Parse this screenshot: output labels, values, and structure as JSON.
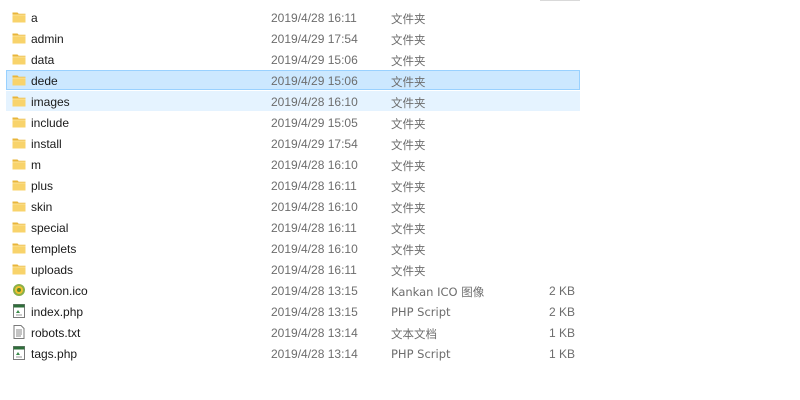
{
  "files": [
    {
      "name": "a",
      "date": "2019/4/28 16:11",
      "type": "文件夹",
      "size": "",
      "icon": "folder-icon"
    },
    {
      "name": "admin",
      "date": "2019/4/29 17:54",
      "type": "文件夹",
      "size": "",
      "icon": "folder-icon"
    },
    {
      "name": "data",
      "date": "2019/4/29 15:06",
      "type": "文件夹",
      "size": "",
      "icon": "folder-icon"
    },
    {
      "name": "dede",
      "date": "2019/4/29 15:06",
      "type": "文件夹",
      "size": "",
      "icon": "folder-icon"
    },
    {
      "name": "images",
      "date": "2019/4/28 16:10",
      "type": "文件夹",
      "size": "",
      "icon": "folder-icon"
    },
    {
      "name": "include",
      "date": "2019/4/29 15:05",
      "type": "文件夹",
      "size": "",
      "icon": "folder-icon"
    },
    {
      "name": "install",
      "date": "2019/4/29 17:54",
      "type": "文件夹",
      "size": "",
      "icon": "folder-icon"
    },
    {
      "name": "m",
      "date": "2019/4/28 16:10",
      "type": "文件夹",
      "size": "",
      "icon": "folder-icon"
    },
    {
      "name": "plus",
      "date": "2019/4/28 16:11",
      "type": "文件夹",
      "size": "",
      "icon": "folder-icon"
    },
    {
      "name": "skin",
      "date": "2019/4/28 16:10",
      "type": "文件夹",
      "size": "",
      "icon": "folder-icon"
    },
    {
      "name": "special",
      "date": "2019/4/28 16:11",
      "type": "文件夹",
      "size": "",
      "icon": "folder-icon"
    },
    {
      "name": "templets",
      "date": "2019/4/28 16:10",
      "type": "文件夹",
      "size": "",
      "icon": "folder-icon"
    },
    {
      "name": "uploads",
      "date": "2019/4/28 16:11",
      "type": "文件夹",
      "size": "",
      "icon": "folder-icon"
    },
    {
      "name": "favicon.ico",
      "date": "2019/4/28 13:15",
      "type": "Kankan ICO 图像",
      "size": "2 KB",
      "icon": "image-file-icon"
    },
    {
      "name": "index.php",
      "date": "2019/4/28 13:15",
      "type": "PHP Script",
      "size": "2 KB",
      "icon": "php-file-icon"
    },
    {
      "name": "robots.txt",
      "date": "2019/4/28 13:14",
      "type": "文本文档",
      "size": "1 KB",
      "icon": "text-file-icon"
    },
    {
      "name": "tags.php",
      "date": "2019/4/28 13:14",
      "type": "PHP Script",
      "size": "1 KB",
      "icon": "php-file-icon"
    }
  ],
  "selected_index": 3,
  "hover_index": 4,
  "colors": {
    "selected_bg": "#cce8ff",
    "selected_border": "#99d1ff",
    "hover_bg": "#e5f3ff",
    "folder": "#f5c242",
    "meta_text": "#6d6d6d"
  }
}
